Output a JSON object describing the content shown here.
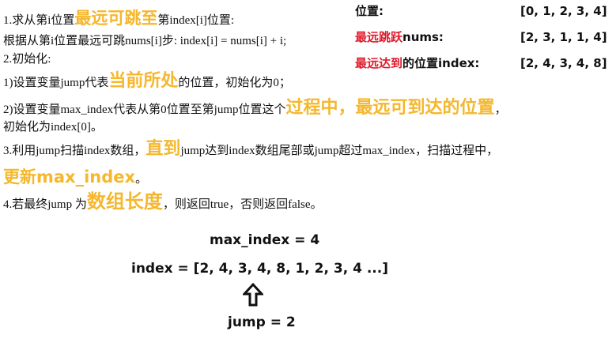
{
  "steps": {
    "s1_prefix": "1.求从第i位置",
    "s1_hl": "最远可跳至",
    "s1_suffix": "第index[i]位置:",
    "s1_line2": "根据从第i位置最远可跳nums[i]步: index[i] = nums[i] + i;",
    "s2_title": "2.初始化:",
    "s2_1_prefix": "1)设置变量jump代表",
    "s2_1_hl": "当前所处",
    "s2_1_suffix": "的位置，初始化为0；",
    "s2_2_prefix": "2)设置变量max_index代表从第0位置至第jump位置这个",
    "s2_2_hl": "过程中，最远可到达的位置",
    "s2_2_suffix": "，",
    "s2_2_line2": "初始化为index[0]。",
    "s3_prefix": "3.利用jump扫描index数组，",
    "s3_hl": "直到",
    "s3_suffix": "jump达到index数组尾部或jump超过max_index，扫描过程中，",
    "s3_line2_hl": "更新max_index",
    "s3_line2_suffix": "。",
    "s4_prefix": "4.若最终jump 为",
    "s4_hl": "数组长度",
    "s4_suffix": "，则返回true，否则返回false。"
  },
  "table": {
    "row1_label": "位置:",
    "row1_value": "[0, 1, 2, 3, 4]",
    "row2_label_red": "最远跳跃",
    "row2_label_rest": "nums:",
    "row2_value": "[2, 3, 1, 1, 4]",
    "row3_label_red": "最远达到",
    "row3_label_rest": "的位置index:",
    "row3_value": "[2, 4, 3, 4, 8]"
  },
  "example": {
    "max_index_text": "max_index = 4",
    "index_text": "index = [2,  4,  3,  4,  8,  1,  2,  3,  4 ...]",
    "jump_text": "jump = 2"
  },
  "colors": {
    "highlight": "#f5b72d",
    "red": "#e0182a",
    "text": "#111111"
  },
  "icons": {
    "pointer": "hollow-up-arrow-icon"
  }
}
